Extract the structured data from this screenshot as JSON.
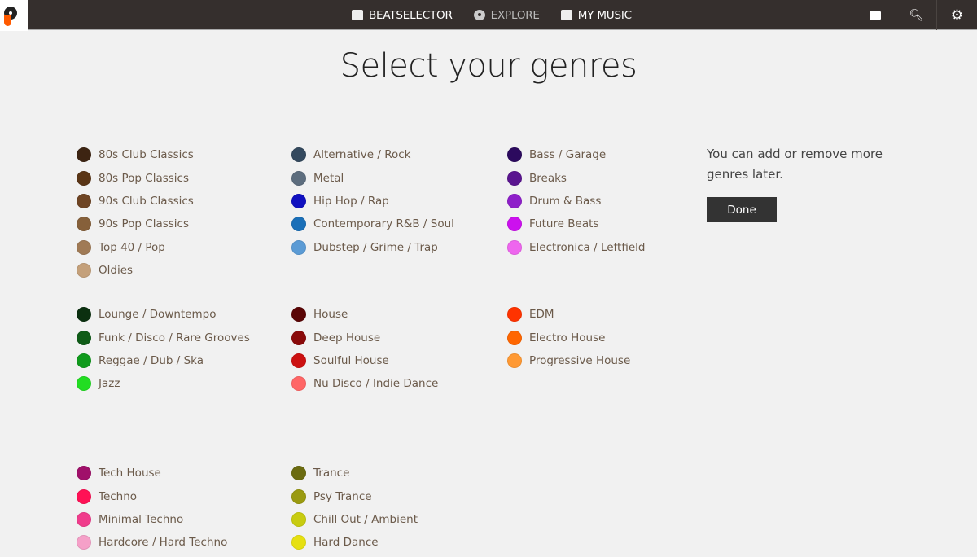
{
  "nav": {
    "items": [
      {
        "label": "BEATSELECTOR",
        "icon": "beatselector-icon"
      },
      {
        "label": "EXPLORE",
        "icon": "disc-icon"
      },
      {
        "label": "MY MUSIC",
        "icon": "box-icon"
      }
    ],
    "right": [
      "chat-icon",
      "search-icon",
      "gear-icon"
    ]
  },
  "title": "Select your genres",
  "note": "You can add or remove more genres later.",
  "done_label": "Done",
  "groups": [
    {
      "col": 0,
      "row": 0,
      "items": [
        [
          "80s Club Classics",
          "#3d2412"
        ],
        [
          "80s Pop Classics",
          "#5a3516"
        ],
        [
          "90s Club Classics",
          "#6e4423"
        ],
        [
          "90s Pop Classics",
          "#86603a"
        ],
        [
          "Top 40 / Pop",
          "#a07a55"
        ],
        [
          "Oldies",
          "#c4a07a"
        ]
      ]
    },
    {
      "col": 1,
      "row": 0,
      "items": [
        [
          "Alternative / Rock",
          "#34495e"
        ],
        [
          "Metal",
          "#5d6d7e"
        ],
        [
          "Hip Hop / Rap",
          "#1010c0"
        ],
        [
          "Contemporary R&B / Soul",
          "#1a6fb8"
        ],
        [
          "Dubstep / Grime / Trap",
          "#5b9bd5"
        ]
      ]
    },
    {
      "col": 2,
      "row": 0,
      "items": [
        [
          "Bass / Garage",
          "#2c0a5e"
        ],
        [
          "Breaks",
          "#5a158f"
        ],
        [
          "Drum & Bass",
          "#8e1fc9"
        ],
        [
          "Future Beats",
          "#cc11ee"
        ],
        [
          "Electronica / Leftfield",
          "#ee66ee"
        ]
      ]
    },
    {
      "col": 0,
      "row": 1,
      "items": [
        [
          "Lounge / Downtempo",
          "#0b3010"
        ],
        [
          "Funk / Disco / Rare Grooves",
          "#0f5c17"
        ],
        [
          "Reggae / Dub / Ska",
          "#109a1c"
        ],
        [
          "Jazz",
          "#22dd22"
        ]
      ]
    },
    {
      "col": 1,
      "row": 1,
      "items": [
        [
          "House",
          "#5a0505"
        ],
        [
          "Deep House",
          "#8a0a0a"
        ],
        [
          "Soulful House",
          "#cc1111"
        ],
        [
          "Nu Disco / Indie Dance",
          "#ff6666"
        ]
      ]
    },
    {
      "col": 2,
      "row": 1,
      "items": [
        [
          "EDM",
          "#ff3300"
        ],
        [
          "Electro House",
          "#ff6600"
        ],
        [
          "Progressive House",
          "#ff9933"
        ]
      ]
    },
    {
      "col": 0,
      "row": 2,
      "items": [
        [
          "Tech House",
          "#a0106a"
        ],
        [
          "Techno",
          "#ff1155"
        ],
        [
          "Minimal Techno",
          "#f03c8c"
        ],
        [
          "Hardcore / Hard Techno",
          "#f5a0c8"
        ]
      ]
    },
    {
      "col": 1,
      "row": 2,
      "items": [
        [
          "Trance",
          "#6b6b10"
        ],
        [
          "Psy Trance",
          "#9a9a10"
        ],
        [
          "Chill Out / Ambient",
          "#c8cc10"
        ],
        [
          "Hard Dance",
          "#e6e010"
        ]
      ]
    }
  ]
}
